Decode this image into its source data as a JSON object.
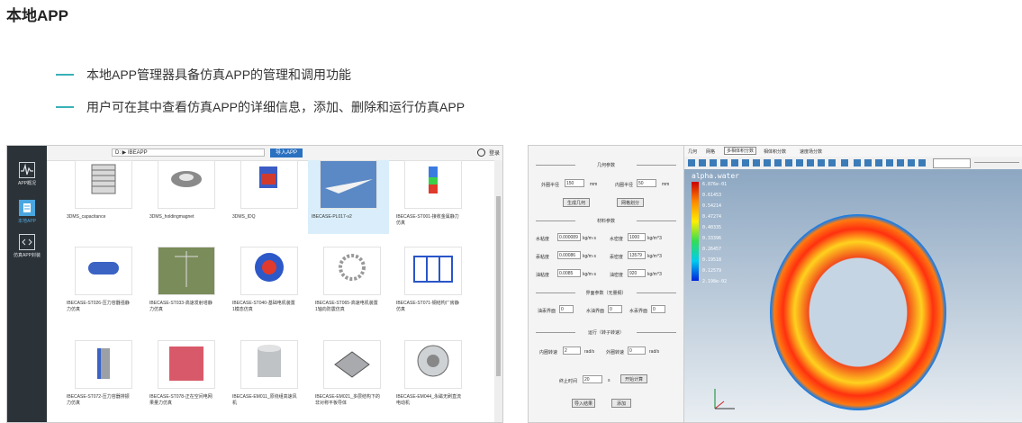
{
  "page": {
    "title": "本地APP",
    "bullets": [
      "本地APP管理器具备仿真APP的管理和调用功能",
      "用户可在其中查看仿真APP的详细信息，添加、删除和运行仿真APP"
    ]
  },
  "left_app": {
    "sidebar": [
      {
        "label": "APP概况",
        "icon": "waveform-icon"
      },
      {
        "label": "本地APP",
        "icon": "document-icon"
      },
      {
        "label": "仿真APP封装",
        "icon": "code-icon"
      }
    ],
    "path_value": "D: ▶ IBEAPP",
    "import_label": "导入APP",
    "login_label": "登录",
    "cards": [
      {
        "caption": "3DMS_capacitance",
        "icon": "capacitor-thumbnail-icon"
      },
      {
        "caption": "3DMS_holdingmagnet",
        "icon": "magnet-thumbnail-icon"
      },
      {
        "caption": "3DMS_IDQ",
        "icon": "idq-thumbnail-icon"
      },
      {
        "caption": "IBECASE-PL017-v2",
        "icon": "airplane-thumbnail-icon",
        "selected": true
      },
      {
        "caption": "IBECASE-ST001-接收金属静力\n仿真",
        "icon": "metal-part-thumbnail-icon"
      },
      {
        "caption": "IBECASE-ST026-压力容器强静\n力仿真",
        "icon": "pressure-vessel-thumbnail-icon"
      },
      {
        "caption": "IBECASE-ST033-高速发射塔静\n力仿真",
        "icon": "tower-thumbnail-icon"
      },
      {
        "caption": "IBECASE-ST040-基础电机装置\n1模态仿真",
        "icon": "motor-thumbnail-icon"
      },
      {
        "caption": "IBECASE-ST065-高速电机装置\n1轴向防震仿真",
        "icon": "gear-thumbnail-icon"
      },
      {
        "caption": "IBECASE-ST071-钢结构厂房静\n仿真",
        "icon": "steel-frame-thumbnail-icon"
      },
      {
        "caption": "IBECASE-ST072-压力容器排振\n力仿真",
        "icon": "vessel-thumbnail-icon"
      },
      {
        "caption": "IBECASE-ST078-正在空间电网\n果量力仿真",
        "icon": "grid-thumbnail-icon"
      },
      {
        "caption": "IBECASE-EM011_原绕组高速风\n机",
        "icon": "cylinder-thumbnail-icon"
      },
      {
        "caption": "IBECASE-EM021_多层结构下的\n非对称平板导体",
        "icon": "plate-thumbnail-icon"
      },
      {
        "caption": "IBECASE-EM044_永磁无刷直流\n电动机",
        "icon": "bldc-motor-thumbnail-icon"
      }
    ]
  },
  "right_app": {
    "sections": [
      "几何参数",
      "材料参数",
      "界面参数（无量纲）",
      "运行（转子转速）"
    ],
    "fields": {
      "outer_radius_label": "外圈半径",
      "outer_radius_value": "150",
      "outer_radius_unit": "mm",
      "inner_radius_label": "内圈半径",
      "inner_radius_value": "50",
      "inner_radius_unit": "mm",
      "btn_build_geometry": "生成几何",
      "btn_mesh": "网格划分",
      "water_visc_label": "水粘度",
      "water_visc_value": "0.000089",
      "water_visc_unit": "kg/m·s",
      "water_density_label": "水密度",
      "water_density_value": "1000",
      "water_density_unit": "kg/m^3",
      "hg_visc_label": "汞粘度",
      "hg_visc_value": "0.00086",
      "hg_visc_unit": "kg/m·s",
      "hg_density_label": "汞密度",
      "hg_density_value": "13579",
      "hg_density_unit": "kg/m^3",
      "oil_visc_label": "油粘度",
      "oil_visc_value": "0.0085",
      "oil_visc_unit": "kg/m·s",
      "oil_density_label": "油密度",
      "oil_density_value": "920",
      "oil_density_unit": "kg/m^3",
      "oil_if_label": "油汞界面",
      "oil_if_value": "0",
      "water_if_label": "水油界面",
      "water_if_value": "0",
      "hg_if_label": "水汞界面",
      "hg_if_value": "0",
      "inner_speed_label": "内圈转速",
      "inner_speed_value": "2",
      "inner_speed_unit": "rad/s",
      "outer_speed_label": "外圈转速",
      "outer_speed_value": "0",
      "outer_speed_unit": "rad/s",
      "stop_time_label": "终止时间",
      "stop_time_value": "20",
      "stop_time_unit": "s",
      "btn_compute": "开始计算",
      "btn_import_results": "导入结果",
      "btn_add": "添加"
    },
    "viewer": {
      "tabs": [
        "几何",
        "网格",
        "多相体积分数",
        "相体积分数",
        "速度场分数"
      ],
      "active_tab_index": 2,
      "variable": "alpha.water",
      "colorbar_labels": [
        "6.876e-01",
        "0.61453",
        "0.54214",
        "0.47274",
        "0.40335",
        "0.33396",
        "0.26457",
        "0.19518",
        "0.12579",
        "2.198e-02"
      ]
    },
    "colors": {
      "accent_blue": "#2a71c0",
      "dash_teal": "#3ab0b8",
      "sidebar_dark": "#2c3338"
    }
  }
}
